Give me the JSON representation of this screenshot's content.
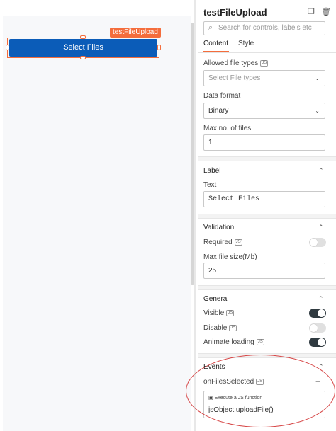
{
  "canvas": {
    "widget_tag": "testFileUpload",
    "button_label": "Select Files"
  },
  "pane": {
    "title": "testFileUpload",
    "icons": {
      "copy": "copy-icon",
      "delete": "trash-icon",
      "search": "search-icon"
    },
    "search_placeholder": "Search for controls, labels etc",
    "tabs": [
      {
        "label": "Content",
        "active": true
      },
      {
        "label": "Style",
        "active": false
      }
    ],
    "content": {
      "allowed_file_types_label": "Allowed file types",
      "allowed_file_types_placeholder": "Select File types",
      "data_format_label": "Data format",
      "data_format_value": "Binary",
      "max_files_label": "Max no. of files",
      "max_files_value": "1"
    },
    "label_section": {
      "title": "Label",
      "text_label": "Text",
      "text_value": "Select Files"
    },
    "validation_section": {
      "title": "Validation",
      "required_label": "Required",
      "required_on": false,
      "max_size_label": "Max file size(Mb)",
      "max_size_value": "25"
    },
    "general_section": {
      "title": "General",
      "visible_label": "Visible",
      "visible_on": true,
      "disable_label": "Disable",
      "disable_on": false,
      "animate_label": "Animate loading",
      "animate_on": true
    },
    "events_section": {
      "title": "Events",
      "event_label": "onFilesSelected",
      "action_type": "Execute a JS function",
      "action_value": "jsObject.uploadFile()"
    },
    "js_badge": "JS"
  },
  "colors": {
    "accent": "#f46d3c",
    "button": "#0b5cb8",
    "annotation": "#d64545"
  }
}
